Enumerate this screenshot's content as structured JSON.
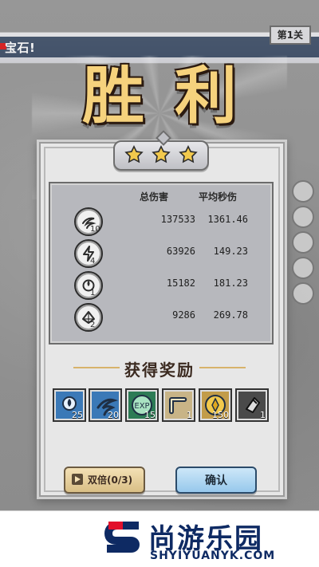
{
  "topbar": {
    "ticker_text": "宝石!",
    "level_tag": "第1关"
  },
  "result": {
    "title": "胜利",
    "stars": 3
  },
  "stats": {
    "header_total_damage": "总伤害",
    "header_avg_dps": "平均秒伤",
    "rows": [
      {
        "icon": "wind-blade-icon",
        "count": "10",
        "total_damage": "137533",
        "avg_dps": "1361.46"
      },
      {
        "icon": "lightning-icon",
        "count": "4",
        "total_damage": "63926",
        "avg_dps": "149.23"
      },
      {
        "icon": "spirit-orb-icon",
        "count": "1",
        "total_damage": "15182",
        "avg_dps": "181.23"
      },
      {
        "icon": "crystal-icon",
        "count": "2",
        "total_damage": "9286",
        "avg_dps": "269.78"
      }
    ]
  },
  "rewards": {
    "title": "获得奖励",
    "items": [
      {
        "icon": "skill-card-orb-icon",
        "qty": "25"
      },
      {
        "icon": "skill-card-wind-icon",
        "qty": "20"
      },
      {
        "icon": "exp-potion-icon",
        "qty": "15"
      },
      {
        "icon": "scroll-icon",
        "qty": "1"
      },
      {
        "icon": "gold-coin-icon",
        "qty": "150"
      },
      {
        "icon": "shard-icon",
        "qty": "1"
      }
    ]
  },
  "buttons": {
    "double_label": "双倍(0/3)",
    "confirm_label": "确认"
  },
  "branding": {
    "name_cn": "尚游乐园",
    "name_en": "SHYIYUANYK.COM",
    "logo_letter": "S",
    "logo_colors": {
      "blue": "#0e2a63",
      "red": "#e2102b"
    }
  },
  "colors": {
    "victory_gold": "#f6d27d",
    "star_gold": "#f2c94c",
    "confirm_blue": "#97c8ec",
    "double_tan": "#d9bf86"
  }
}
